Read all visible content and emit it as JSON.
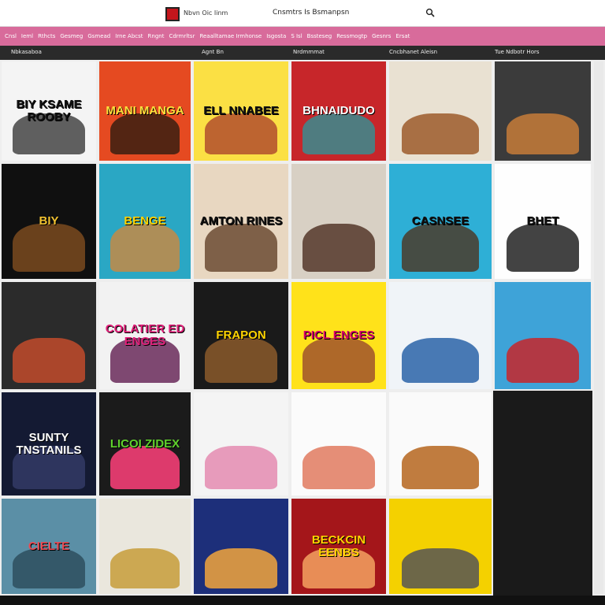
{
  "header": {
    "logo_text": "Nbvn Oic Iinm",
    "title": "Cnsmtrs Is Bsmanpsn",
    "search_icon": "search-icon"
  },
  "nav": {
    "items": [
      "Cnsl",
      "Ieml",
      "Rthcts",
      "Gesmeg",
      "Gsmead",
      "Irne Abcst",
      "Rngnt",
      "Cdrmrltsr",
      "Reaalltamae Irmhonse",
      "Isgosta",
      "S Isl",
      "Bssteseg",
      "Ressmogtp",
      "Gesnrs",
      "Ersat"
    ]
  },
  "strip": {
    "labels": [
      "Nbkasaboa",
      "Agnt Bn",
      "Nrdmmmat",
      "Cncbhanet Aleisn",
      "Tue Ndbotr Hors"
    ]
  },
  "covers": [
    {
      "title": "BIY KSAME ROOBY",
      "bg": "#f4f4f4",
      "fg": "#111",
      "art": "#444"
    },
    {
      "title": "BIY",
      "bg": "#101010",
      "fg": "#f2c230",
      "art": "#7a4a1e"
    },
    {
      "title": "",
      "bg": "#2b2b2b",
      "fg": "#ffd400",
      "art": "#c24b2b"
    },
    {
      "title": "SUNTY TNSTANILS",
      "bg": "#141a33",
      "fg": "#fff",
      "art": "#333b66"
    },
    {
      "title": "CIELTE",
      "bg": "#5b8fa6",
      "fg": "#e84b54",
      "art": "#2e4f5e"
    },
    {
      "title": "MANI MANGA",
      "bg": "#e54a21",
      "fg": "#ffe13d",
      "art": "#3a1f10"
    },
    {
      "title": "BENGE",
      "bg": "#2aa7c4",
      "fg": "#ffd400",
      "art": "#c48a45"
    },
    {
      "title": "COLATIER ED ENGES",
      "bg": "#f2f2f2",
      "fg": "#e2207a",
      "art": "#6a2a5a"
    },
    {
      "title": "LICOI ZIDEX",
      "bg": "#1b1b1b",
      "fg": "#5fd12c",
      "art": "#ff3f7a"
    },
    {
      "title": "",
      "bg": "#eae7dd",
      "fg": "#222",
      "art": "#c79c3a"
    },
    {
      "title": "ELL NNABEE",
      "bg": "#fbe044",
      "fg": "#111",
      "art": "#b24d2d"
    },
    {
      "title": "AMTON RINES",
      "bg": "#e8d7c1",
      "fg": "#111",
      "art": "#6b4b32"
    },
    {
      "title": "FRAPON",
      "bg": "#1a1a1a",
      "fg": "#ffd400",
      "art": "#8b5a2b"
    },
    {
      "title": "",
      "bg": "#f4f4f4",
      "fg": "#111",
      "art": "#e48bb0"
    },
    {
      "title": "",
      "bg": "#1d2f7a",
      "fg": "#ffd400",
      "art": "#f2a53c"
    },
    {
      "title": "BHNAIDUDO",
      "bg": "#c7262a",
      "fg": "#fff",
      "art": "#3a8c8f"
    },
    {
      "title": "",
      "bg": "#d8d0c4",
      "fg": "#111",
      "art": "#55372a"
    },
    {
      "title": "PICL ENGES",
      "bg": "#ffe21a",
      "fg": "#d9006c",
      "art": "#a0522d"
    },
    {
      "title": "",
      "bg": "#fbfbfb",
      "fg": "#222",
      "art": "#e07a5f"
    },
    {
      "title": "BECKCIN EENBS",
      "bg": "#a4161a",
      "fg": "#ffd400",
      "art": "#f4a261"
    },
    {
      "title": "",
      "bg": "#e9e1d2",
      "fg": "#111",
      "art": "#9c5a2c"
    },
    {
      "title": "CASNSEE",
      "bg": "#2eafd6",
      "fg": "#111",
      "art": "#4a3b2a"
    },
    {
      "title": "",
      "bg": "#f0f4f8",
      "fg": "#111",
      "art": "#2a63a8"
    },
    {
      "title": "",
      "bg": "#fafafa",
      "fg": "#111",
      "art": "#b5651d"
    },
    {
      "title": "",
      "bg": "#f4d100",
      "fg": "#111",
      "art": "#555"
    },
    {
      "title": "",
      "bg": "#3b3b3b",
      "fg": "#fff",
      "art": "#c77d3a"
    },
    {
      "title": "BHET",
      "bg": "#fefefe",
      "fg": "#111",
      "art": "#222"
    },
    {
      "title": "",
      "bg": "#3ea3d8",
      "fg": "#e2207a",
      "art": "#c7262a"
    }
  ]
}
